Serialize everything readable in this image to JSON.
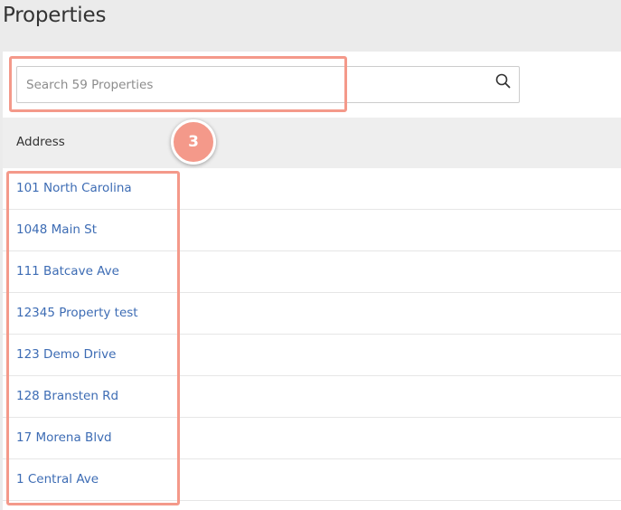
{
  "page": {
    "title": "Properties"
  },
  "search": {
    "placeholder": "Search 59 Properties"
  },
  "table": {
    "columns": [
      {
        "label": "Address"
      }
    ],
    "rows": [
      {
        "address": "101 North Carolina"
      },
      {
        "address": "1048 Main St"
      },
      {
        "address": "111 Batcave Ave"
      },
      {
        "address": "12345 Property test"
      },
      {
        "address": "123 Demo Drive"
      },
      {
        "address": "128 Bransten Rd"
      },
      {
        "address": "17 Morena Blvd"
      },
      {
        "address": "1 Central Ave"
      }
    ]
  },
  "annotation": {
    "step": "3"
  },
  "colors": {
    "link": "#3d6cb4",
    "highlight": "#f4998a",
    "header_bg": "#eeeeee",
    "page_bg": "#ebebeb"
  },
  "icons": {
    "search": "search-icon"
  }
}
